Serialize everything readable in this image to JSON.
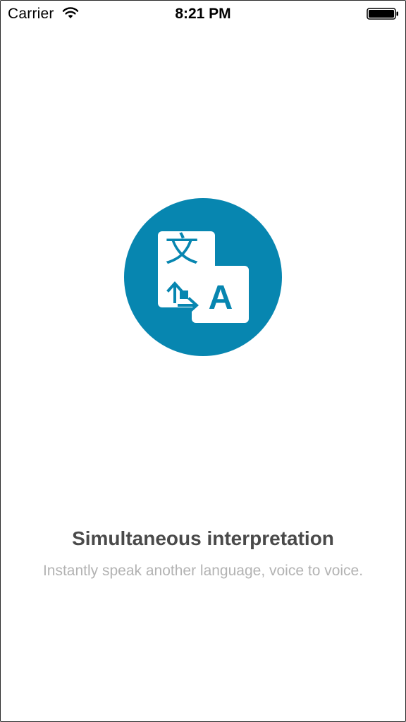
{
  "status_bar": {
    "carrier": "Carrier",
    "time": "8:21 PM",
    "wifi_icon": "wifi-icon",
    "battery_icon": "battery-icon"
  },
  "onboarding": {
    "icon": "translate-icon",
    "icon_glyph_source": "文",
    "icon_glyph_target": "A",
    "accent_color": "#0786b0",
    "title": "Simultaneous interpretation",
    "subtitle": "Instantly speak another language, voice to voice."
  }
}
